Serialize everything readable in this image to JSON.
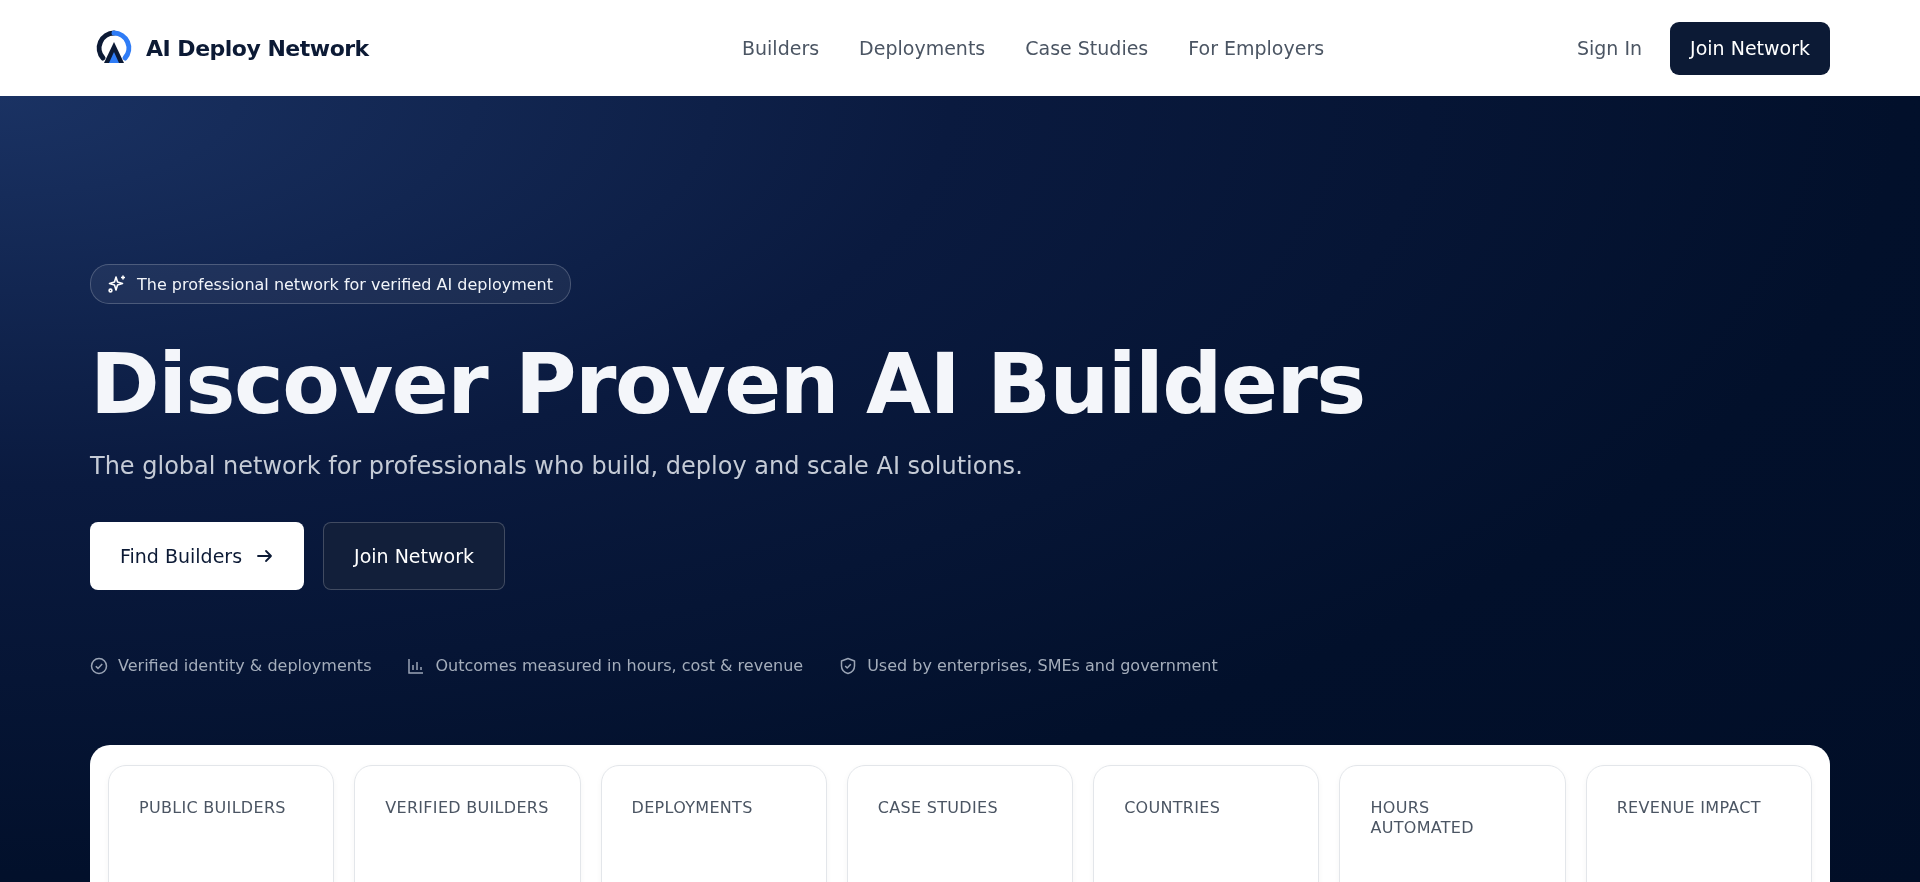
{
  "header": {
    "brand": "AI Deploy Network",
    "nav": [
      {
        "label": "Builders"
      },
      {
        "label": "Deployments"
      },
      {
        "label": "Case Studies"
      },
      {
        "label": "For Employers"
      }
    ],
    "sign_in": "Sign In",
    "join": "Join Network"
  },
  "hero": {
    "badge": "The professional network for verified AI deployment",
    "title": "Discover Proven AI Builders",
    "subtitle": "The global network for professionals who build, deploy and scale AI solutions.",
    "buttons": [
      {
        "kind": "primary",
        "label": "Find Builders"
      },
      {
        "kind": "secondary",
        "label": "Join Network"
      }
    ],
    "features": [
      {
        "kind": "check",
        "label": "Verified identity & deployments"
      },
      {
        "kind": "chart",
        "label": "Outcomes measured in hours, cost & revenue"
      },
      {
        "kind": "shield",
        "label": "Used by enterprises, SMEs and government"
      }
    ]
  },
  "stats": [
    {
      "label": "PUBLIC BUILDERS"
    },
    {
      "label": "VERIFIED BUILDERS"
    },
    {
      "label": "DEPLOYMENTS"
    },
    {
      "label": "CASE STUDIES"
    },
    {
      "label": "COUNTRIES"
    },
    {
      "label": "HOURS AUTOMATED"
    },
    {
      "label": "REVENUE IMPACT"
    }
  ]
}
